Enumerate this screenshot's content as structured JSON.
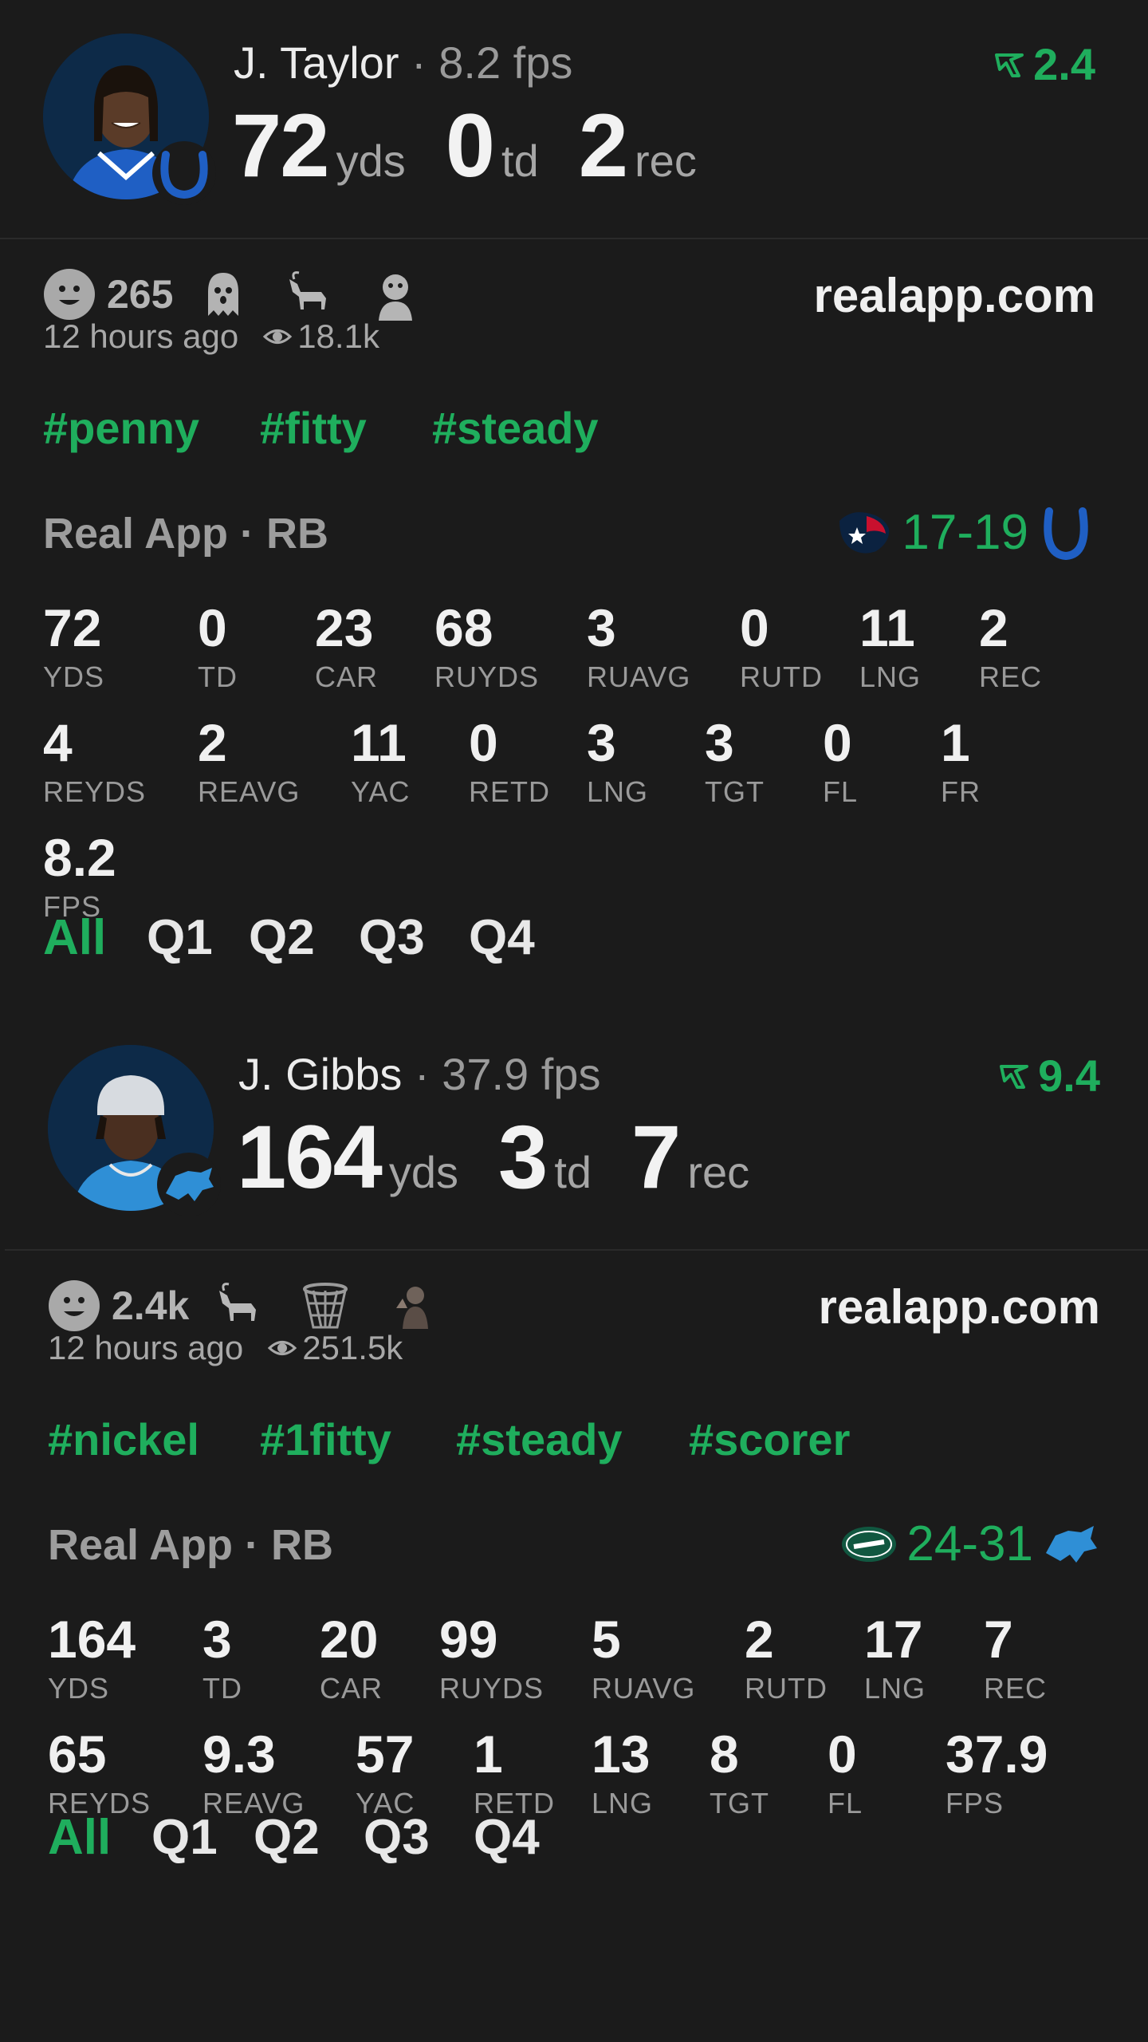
{
  "colors": {
    "accent": "#1fae5d",
    "background": "#1b1b1b"
  },
  "cards": [
    {
      "player": "J. Taylor",
      "fps_text": "8.2 fps",
      "trend": "2.4",
      "team_icon": "colts-horseshoe-icon",
      "summary": {
        "yds": "72",
        "td": "0",
        "rec": "2"
      },
      "reaction_count": "265",
      "emojis": [
        "smiley-icon",
        "ghost-icon",
        "goat-icon",
        "monkey-icon"
      ],
      "site": "realapp.com",
      "time": "12 hours ago",
      "views": "18.1k",
      "tags": [
        "#penny",
        "#fitty",
        "#steady"
      ],
      "source": "Real App · RB",
      "score": "17-19",
      "away_logo": "texans-logo",
      "home_logo": "colts-logo",
      "stats_row1": [
        {
          "v": "72",
          "l": "YDS"
        },
        {
          "v": "0",
          "l": "TD"
        },
        {
          "v": "23",
          "l": "CAR"
        },
        {
          "v": "68",
          "l": "RUYDS"
        },
        {
          "v": "3",
          "l": "RUAVG"
        },
        {
          "v": "0",
          "l": "RUTD"
        },
        {
          "v": "11",
          "l": "LNG"
        },
        {
          "v": "2",
          "l": "REC"
        }
      ],
      "stats_row2": [
        {
          "v": "4",
          "l": "REYDS"
        },
        {
          "v": "2",
          "l": "REAVG"
        },
        {
          "v": "11",
          "l": "YAC"
        },
        {
          "v": "0",
          "l": "RETD"
        },
        {
          "v": "3",
          "l": "LNG"
        },
        {
          "v": "3",
          "l": "TGT"
        },
        {
          "v": "0",
          "l": "FL"
        },
        {
          "v": "1",
          "l": "FR"
        }
      ],
      "stats_row3": [
        {
          "v": "8.2",
          "l": "FPS"
        }
      ],
      "quarters": [
        "All",
        "Q1",
        "Q2",
        "Q3",
        "Q4"
      ]
    },
    {
      "player": "J. Gibbs",
      "fps_text": "37.9 fps",
      "trend": "9.4",
      "team_icon": "lions-icon",
      "summary": {
        "yds": "164",
        "td": "3",
        "rec": "7"
      },
      "reaction_count": "2.4k",
      "emojis": [
        "smiley-icon",
        "goat-icon",
        "basketball-net-icon",
        "person-icon"
      ],
      "site": "realapp.com",
      "time": "12 hours ago",
      "views": "251.5k",
      "tags": [
        "#nickel",
        "#1fitty",
        "#steady",
        "#scorer"
      ],
      "source": "Real App · RB",
      "score": "24-31",
      "away_logo": "jets-logo",
      "home_logo": "lions-logo",
      "stats_row1": [
        {
          "v": "164",
          "l": "YDS"
        },
        {
          "v": "3",
          "l": "TD"
        },
        {
          "v": "20",
          "l": "CAR"
        },
        {
          "v": "99",
          "l": "RUYDS"
        },
        {
          "v": "5",
          "l": "RUAVG"
        },
        {
          "v": "2",
          "l": "RUTD"
        },
        {
          "v": "17",
          "l": "LNG"
        },
        {
          "v": "7",
          "l": "REC"
        }
      ],
      "stats_row2": [
        {
          "v": "65",
          "l": "REYDS"
        },
        {
          "v": "9.3",
          "l": "REAVG"
        },
        {
          "v": "57",
          "l": "YAC"
        },
        {
          "v": "1",
          "l": "RETD"
        },
        {
          "v": "13",
          "l": "LNG"
        },
        {
          "v": "8",
          "l": "TGT"
        },
        {
          "v": "0",
          "l": "FL"
        },
        {
          "v": "37.9",
          "l": "FPS"
        }
      ],
      "quarters": [
        "All",
        "Q1",
        "Q2",
        "Q3",
        "Q4"
      ]
    }
  ],
  "units": {
    "yds": "yds",
    "td": "td",
    "rec": "rec"
  }
}
